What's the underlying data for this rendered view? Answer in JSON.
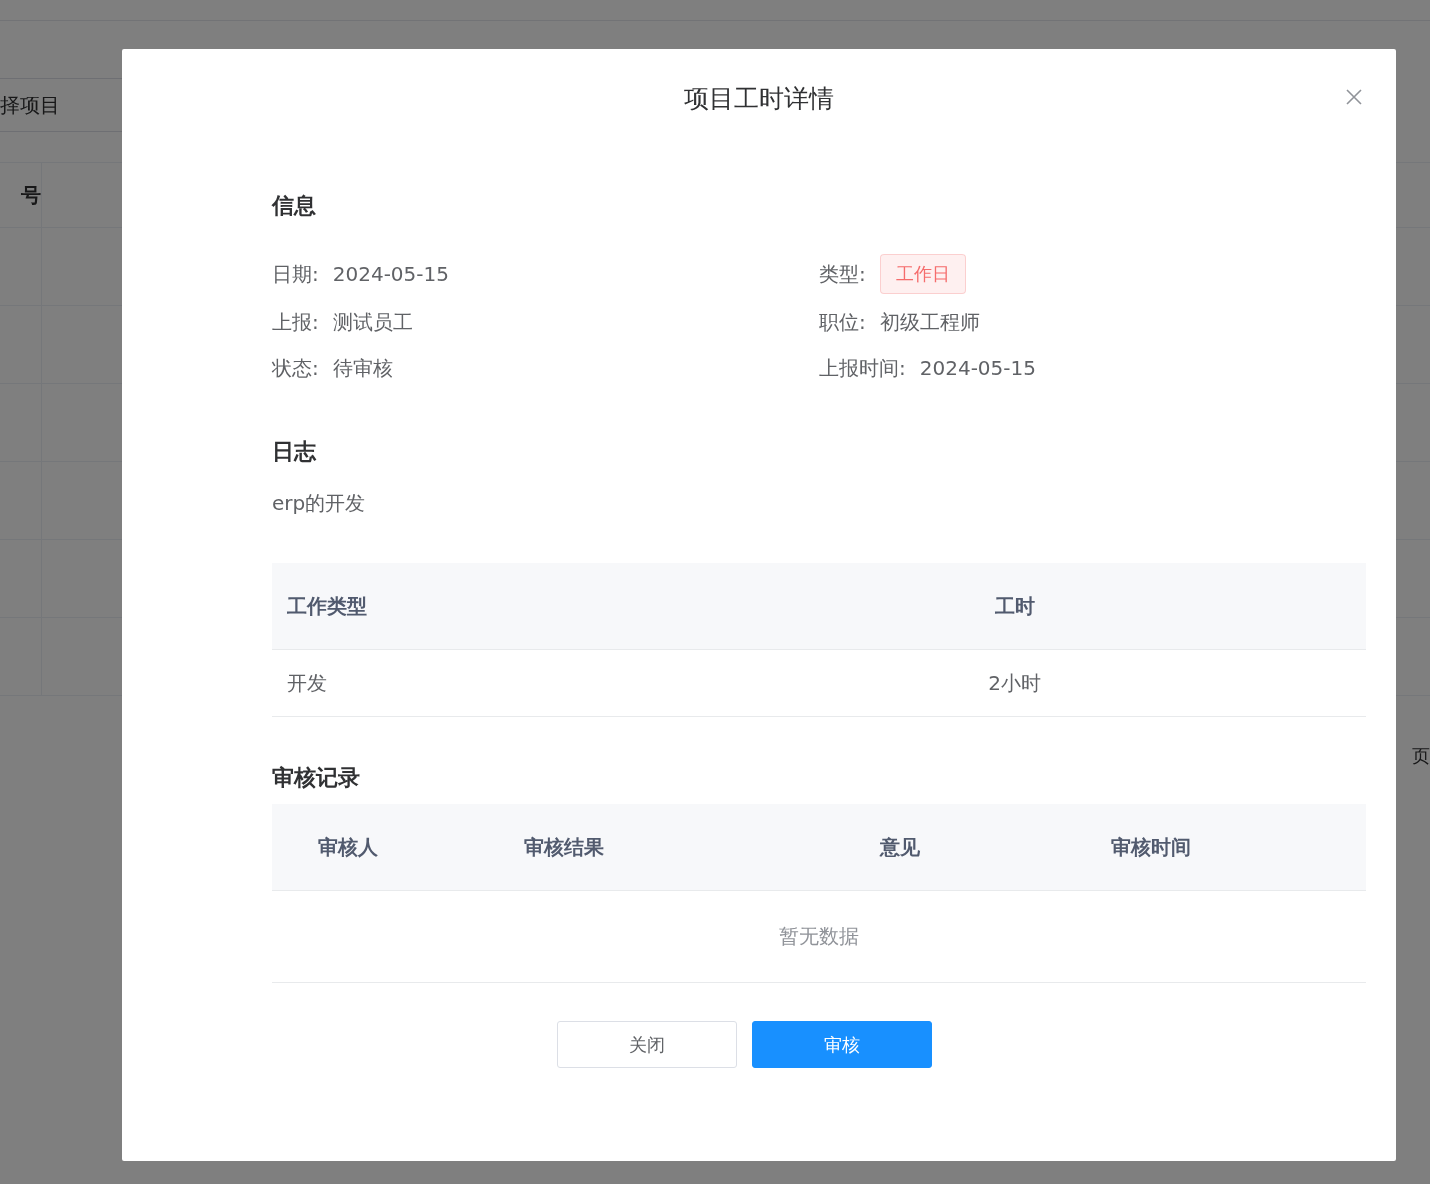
{
  "background": {
    "search": {
      "placeholder": "择项目"
    },
    "table": {
      "columns": [
        "号"
      ]
    },
    "pager_text": "页"
  },
  "dialog": {
    "title": "项目工时详情",
    "info": {
      "heading": "信息",
      "fields": [
        {
          "label": "日期:",
          "value": "2024-05-15",
          "kind": "text"
        },
        {
          "label": "类型:",
          "value": "工作日",
          "kind": "tag",
          "color": "#f56c6c"
        },
        {
          "label": "上报:",
          "value": "测试员工",
          "kind": "text"
        },
        {
          "label": "职位:",
          "value": "初级工程师",
          "kind": "text"
        },
        {
          "label": "状态:",
          "value": "待审核",
          "kind": "text"
        },
        {
          "label": "上报时间:",
          "value": "2024-05-15",
          "kind": "text"
        }
      ]
    },
    "log": {
      "heading": "日志",
      "text": "erp的开发"
    },
    "hours_table": {
      "columns": [
        "工作类型",
        "工时"
      ],
      "rows": [
        [
          "开发",
          "2小时"
        ]
      ]
    },
    "review": {
      "heading": "审核记录",
      "columns": [
        "审核人",
        "审核结果",
        "意见",
        "审核时间"
      ],
      "empty_text": "暂无数据"
    },
    "buttons": [
      {
        "label": "关闭",
        "kind": "default"
      },
      {
        "label": "审核",
        "kind": "primary"
      }
    ]
  }
}
